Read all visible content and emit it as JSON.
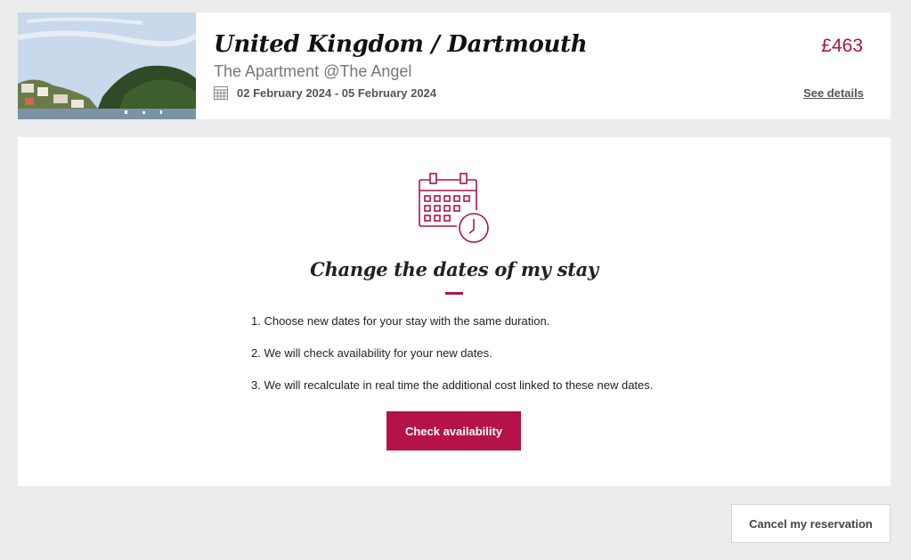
{
  "booking": {
    "destination": "United Kingdom / Dartmouth",
    "hotel": "The Apartment @The Angel",
    "dates": "02 February 2024 - 05 February 2024",
    "price": "£463",
    "see_details_label": "See details"
  },
  "change_dates": {
    "title": "Change the dates of my stay",
    "steps": [
      "1. Choose new dates for your stay with the same duration.",
      "2. We will check availability for your new dates.",
      "3. We will recalculate in real time the additional cost linked to these new dates."
    ],
    "check_button_label": "Check availability"
  },
  "cancel_button_label": "Cancel my reservation",
  "colors": {
    "accent": "#b5124a",
    "background": "#ececec"
  },
  "icons": {
    "dates": "calendar-icon",
    "change_dates": "calendar-clock-icon"
  }
}
